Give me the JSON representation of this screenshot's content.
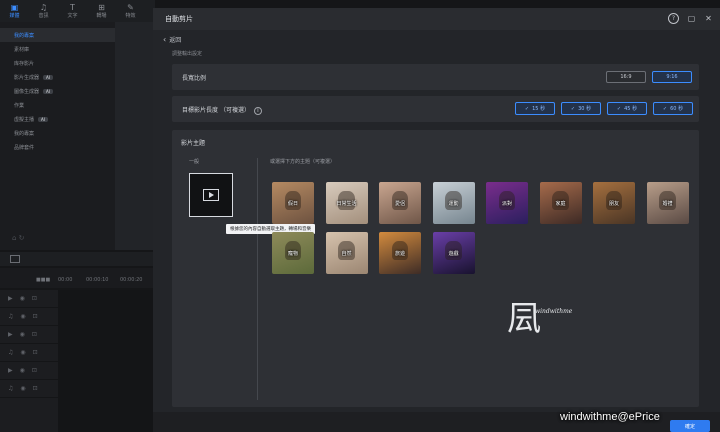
{
  "background_editor": {
    "tabs": [
      {
        "label": "媒體",
        "icon": "media-icon"
      },
      {
        "label": "音訊",
        "icon": "music-icon"
      },
      {
        "label": "文字",
        "icon": "text-icon"
      },
      {
        "label": "轉場",
        "icon": "transition-icon"
      },
      {
        "label": "特效",
        "icon": "effects-icon"
      }
    ],
    "sidebar": [
      {
        "label": "我的專案",
        "active": true
      },
      {
        "label": "素材庫"
      },
      {
        "label": "库存影片"
      },
      {
        "label": "影片生成器",
        "badge": "AI"
      },
      {
        "label": "圖像生成器",
        "badge": "AI"
      },
      {
        "label": "作業"
      },
      {
        "label": "虛擬主播",
        "badge": "AI"
      },
      {
        "label": "我的專案"
      },
      {
        "label": "品牌套件"
      }
    ],
    "timeline": {
      "btn": "■■■",
      "t0": "00:00",
      "t1": "00:00:10",
      "t2": "00:00:20"
    }
  },
  "modal": {
    "title": "自動剪片",
    "back_label": "返回",
    "section_label": "調整輸出設定",
    "aspect": {
      "label": "長寬比例",
      "options": [
        "16:9",
        "9:16"
      ],
      "selected": 1
    },
    "duration": {
      "label": "目標影片長度",
      "optional": "（可複選）",
      "options": [
        "15 秒",
        "30 秒",
        "45 秒",
        "60 秒"
      ]
    },
    "theme": {
      "label": "影片主題",
      "general_label": "一般",
      "choose_label": "或選擇下方的主題（可複選）",
      "tooltip": "根據您的內容自動選取主題，轉場和音樂",
      "themes": [
        {
          "name": "假日",
          "colors": [
            "#b58a62",
            "#6d5240"
          ]
        },
        {
          "name": "日常生活",
          "colors": [
            "#d8cbbd",
            "#a38f7c"
          ]
        },
        {
          "name": "愛侶",
          "colors": [
            "#c9a690",
            "#6f5648"
          ]
        },
        {
          "name": "運動",
          "colors": [
            "#c8d0d6",
            "#76858f"
          ]
        },
        {
          "name": "派對",
          "colors": [
            "#7a2d8c",
            "#2a1f5e"
          ]
        },
        {
          "name": "家庭",
          "colors": [
            "#a66b4b",
            "#3d2a25"
          ]
        },
        {
          "name": "朋友",
          "colors": [
            "#a5703f",
            "#4a3525"
          ]
        },
        {
          "name": "婚禮",
          "colors": [
            "#b89e8a",
            "#5a4a44"
          ]
        },
        {
          "name": "寵物",
          "colors": [
            "#8e8a5a",
            "#5c6a3a"
          ]
        },
        {
          "name": "自然",
          "colors": [
            "#d6c2ad",
            "#9b8672"
          ]
        },
        {
          "name": "旅遊",
          "colors": [
            "#d38b3e",
            "#3e2c26"
          ]
        },
        {
          "name": "遊戲",
          "colors": [
            "#6a3fa8",
            "#18122e"
          ]
        }
      ]
    },
    "confirm_label": "確定"
  },
  "watermark": {
    "logo": "凨",
    "sub": "windwithme"
  },
  "credit": "windwithme@ePrice"
}
